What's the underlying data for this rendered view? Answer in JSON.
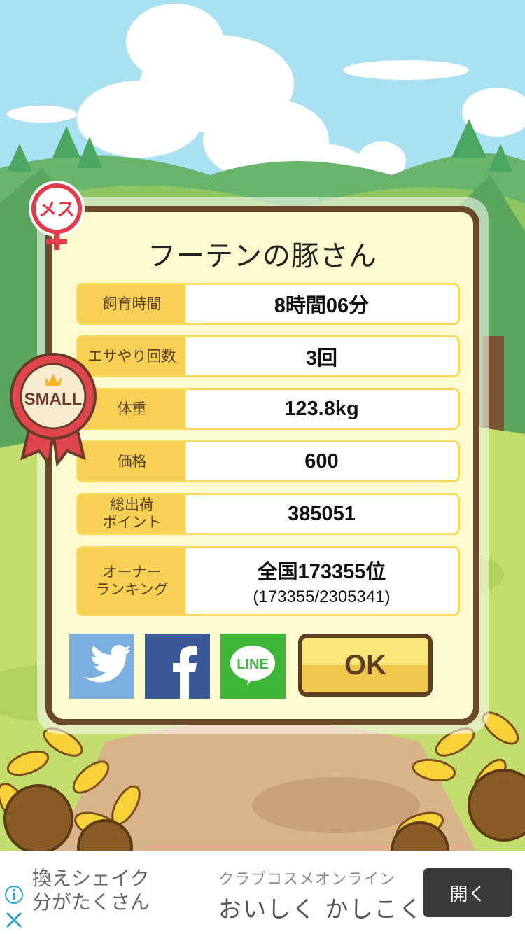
{
  "dialog": {
    "title": "フーテンの豚さん",
    "rows": [
      {
        "label": "飼育時間",
        "value": "8時間06分"
      },
      {
        "label": "エサやり回数",
        "value": "3回"
      },
      {
        "label": "体重",
        "value": "123.8kg"
      },
      {
        "label": "価格",
        "value": "600"
      },
      {
        "label": "総出荷\nポイント",
        "value": "385051"
      },
      {
        "label": "オーナー\nランキング",
        "value": "全国173355位",
        "sub": "(173355/2305341)"
      }
    ],
    "ok_label": "OK"
  },
  "badges": {
    "gender_label": "メス",
    "size_label": "SMALL"
  },
  "social": {
    "line_label": "LINE"
  },
  "ad": {
    "left_text": "換えシェイク\n分がたくさん",
    "small_text": "クラブコスメオンライン",
    "headline": "おいしく かしこく",
    "open_label": "開く"
  },
  "colors": {
    "sky": "#a9e0f2",
    "frame": "#6b4a2a",
    "panel": "#fdfbcf",
    "label_bg": "#f6cf55",
    "twitter": "#7aafe0",
    "facebook": "#3b5998",
    "line": "#3fb638"
  }
}
